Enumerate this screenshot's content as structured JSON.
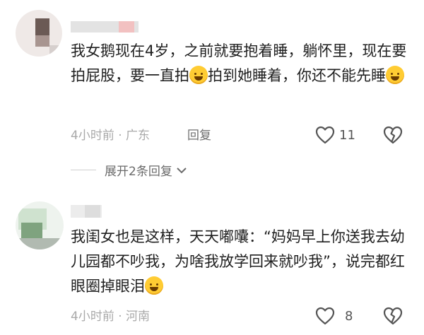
{
  "comments": [
    {
      "text_parts": [
        "我女鹅现在4岁，之前就要抱着睡，躺怀里，现在要拍屁股，要一直拍",
        "拍到她睡着，你还不能先睡"
      ],
      "time_location": "4小时前 · 广东",
      "reply_label": "回复",
      "like_count": "11",
      "expand_label": "展开2条回复"
    },
    {
      "text_parts": [
        "我闺女也是这样，天天嘟囔：“妈妈早上你送我去幼儿园都不吵我，为啥我放学回来就吵我”，说完都红眼圈掉眼泪"
      ],
      "time_location": "4小时前 · 河南",
      "like_count": "8"
    }
  ],
  "colors": {
    "text": "#1f1f1f",
    "meta": "#a9a9a9",
    "reply": "#6f6f6f",
    "emoji": "#ffcc33"
  },
  "icons": [
    "heart-outline-icon",
    "broken-heart-icon",
    "chevron-down-icon",
    "laughing-tears-emoji"
  ]
}
